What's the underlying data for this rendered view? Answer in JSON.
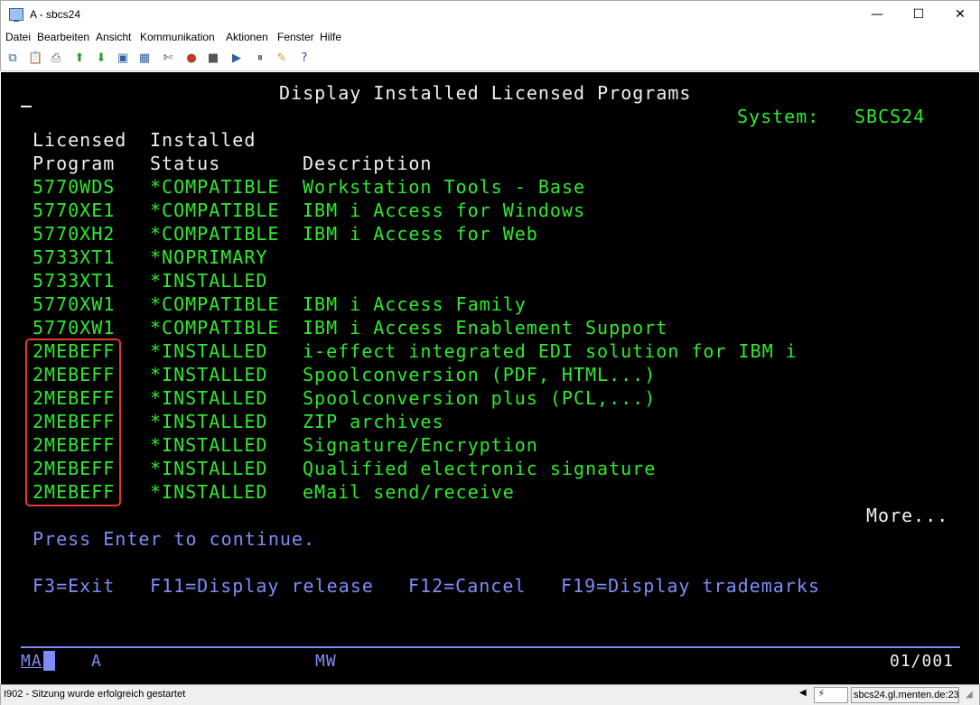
{
  "window": {
    "title": "A - sbcs24",
    "minimize": "—",
    "maximize": "☐",
    "close": "✕"
  },
  "menu": [
    "Datei",
    "Bearbeiten",
    "Ansicht",
    "Kommunikation",
    "Aktionen",
    "Fenster",
    "Hilfe"
  ],
  "toolbar_icons": [
    "copy-icon",
    "paste-icon",
    "print-icon",
    "send-icon",
    "receive-icon",
    "macro-icon",
    "keyboard-icon",
    "settings-icon",
    "record-icon",
    "stop-icon",
    "play-icon",
    "pause-icon",
    "notes-icon",
    "help-icon"
  ],
  "terminal": {
    "cursor": "_",
    "title": "Display Installed Licensed Programs",
    "system_label": "System:",
    "system_value": "SBCS24",
    "header": {
      "col1_line1": "Licensed",
      "col2_line1": "Installed",
      "col1_line2": "Program",
      "col2_line2": "Status",
      "col3_line2": "Description"
    },
    "rows": [
      {
        "program": "5770WDS",
        "status": "*COMPATIBLE",
        "description": "Workstation Tools - Base"
      },
      {
        "program": "5770XE1",
        "status": "*COMPATIBLE",
        "description": "IBM i Access for Windows"
      },
      {
        "program": "5770XH2",
        "status": "*COMPATIBLE",
        "description": "IBM i Access for Web"
      },
      {
        "program": "5733XT1",
        "status": "*NOPRIMARY",
        "description": ""
      },
      {
        "program": "5733XT1",
        "status": "*INSTALLED",
        "description": ""
      },
      {
        "program": "5770XW1",
        "status": "*COMPATIBLE",
        "description": "IBM i Access Family"
      },
      {
        "program": "5770XW1",
        "status": "*COMPATIBLE",
        "description": "IBM i Access Enablement Support"
      },
      {
        "program": "2MEBEFF",
        "status": "*INSTALLED",
        "description": "i-effect integrated EDI solution for IBM i"
      },
      {
        "program": "2MEBEFF",
        "status": "*INSTALLED",
        "description": "Spoolconversion (PDF, HTML...)"
      },
      {
        "program": "2MEBEFF",
        "status": "*INSTALLED",
        "description": "Spoolconversion plus (PCL,...)"
      },
      {
        "program": "2MEBEFF",
        "status": "*INSTALLED",
        "description": "ZIP archives"
      },
      {
        "program": "2MEBEFF",
        "status": "*INSTALLED",
        "description": "Signature/Encryption"
      },
      {
        "program": "2MEBEFF",
        "status": "*INSTALLED",
        "description": "Qualified electronic signature"
      },
      {
        "program": "2MEBEFF",
        "status": "*INSTALLED",
        "description": "eMail send/receive"
      }
    ],
    "more": "More...",
    "prompt": "Press Enter to continue.",
    "fkeys": [
      "F3=Exit",
      "F11=Display release",
      "F12=Cancel",
      "F19=Display trademarks"
    ],
    "oia": {
      "left": "MA",
      "mode": "A",
      "mw": "MW",
      "position": "01/001"
    }
  },
  "status": {
    "message": "I902 - Sitzung wurde erfolgreich gestartet",
    "host": "sbcs24.gl.menten.de:23"
  },
  "colors": {
    "screen_bg": "#000000",
    "green": "#2ee92e",
    "blue": "#7e8cf5",
    "white": "#f0f0f0",
    "highlight": "#e53935"
  }
}
